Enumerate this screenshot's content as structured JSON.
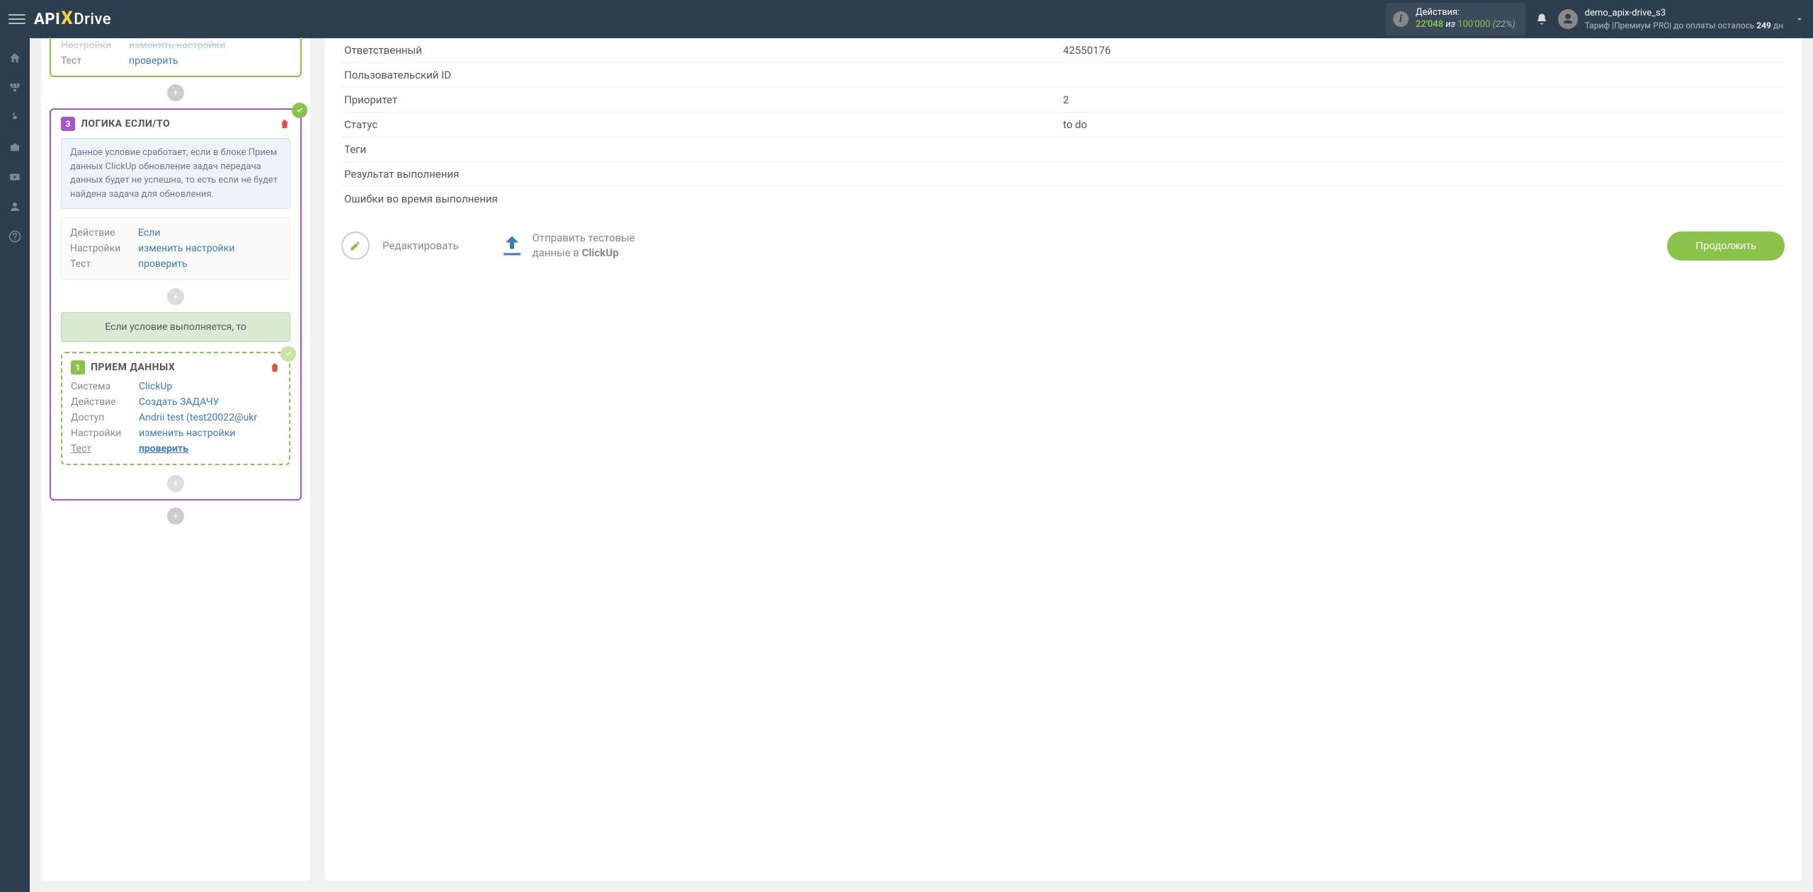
{
  "header": {
    "logo": {
      "api": "API",
      "x": "X",
      "drive": "Drive"
    },
    "actions": {
      "label": "Действия:",
      "count": "22'048",
      "of": "из",
      "max": "100'000",
      "pct": "(22%)"
    },
    "user": {
      "name": "demo_apix-drive_s3",
      "tariff_prefix": "Тариф |Премиум PRO| до оплаты осталось ",
      "days": "249",
      "days_suffix": " дн"
    }
  },
  "workflow": {
    "top_block": {
      "settings_label": "Настройки",
      "settings_value": "изменить настройки",
      "test_label": "Тест",
      "test_value": "проверить"
    },
    "logic_block": {
      "num": "3",
      "title": "ЛОГИКА ЕСЛИ/ТО",
      "desc": "Данное условие сработает, если в блоке Прием данных ClickUp обновление задач передача данных будет не успешна, то есть если не будет найдена задача для обновления.",
      "rows": {
        "action_label": "Действие",
        "action_value": "Если",
        "settings_label": "Настройки",
        "settings_value": "изменить настройки",
        "test_label": "Тест",
        "test_value": "проверить"
      },
      "condition_bar": "Если условие выполняется, то"
    },
    "receive_block": {
      "num": "1",
      "title": "ПРИЕМ ДАННЫХ",
      "rows": {
        "system_label": "Система",
        "system_value": "ClickUp",
        "action_label": "Действие",
        "action_value": "Создать ЗАДАЧУ",
        "access_label": "Доступ",
        "access_value": "Andrii test (test20022@ukr",
        "settings_label": "Настройки",
        "settings_value": "изменить настройки",
        "test_label": "Тест",
        "test_value": "проверить"
      }
    }
  },
  "details": {
    "rows": [
      {
        "key": "Ответственный",
        "value": "42550176"
      },
      {
        "key": "Пользовательский ID",
        "value": ""
      },
      {
        "key": "Приоритет",
        "value": "2"
      },
      {
        "key": "Статус",
        "value": "to do"
      },
      {
        "key": "Теги",
        "value": ""
      },
      {
        "key": "Результат выполнения",
        "value": ""
      },
      {
        "key": "Ошибки во время выполнения",
        "value": ""
      }
    ],
    "edit_label": "Редактировать",
    "send_label_1": "Отправить тестовые",
    "send_label_2": "данные в ",
    "send_target": "ClickUp",
    "continue": "Продолжить"
  }
}
